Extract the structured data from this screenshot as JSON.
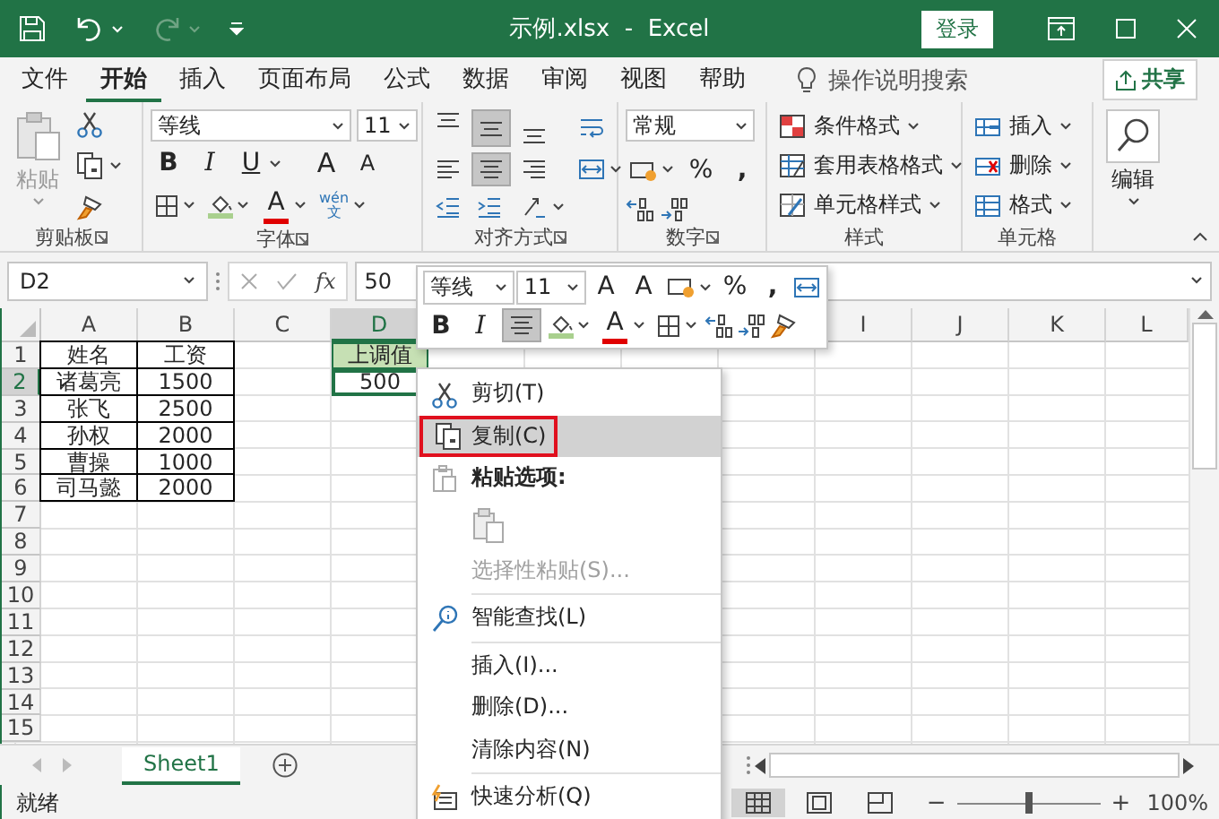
{
  "window": {
    "title": "示例.xlsx  -  Excel",
    "sign_in": "登录",
    "redo_disabled": true
  },
  "ribbon_tabs": [
    {
      "label": "文件",
      "selected": false
    },
    {
      "label": "开始",
      "selected": true
    },
    {
      "label": "插入",
      "selected": false
    },
    {
      "label": "页面布局",
      "selected": false
    },
    {
      "label": "公式",
      "selected": false
    },
    {
      "label": "数据",
      "selected": false
    },
    {
      "label": "审阅",
      "selected": false
    },
    {
      "label": "视图",
      "selected": false
    },
    {
      "label": "帮助",
      "selected": false
    }
  ],
  "tell_me": {
    "placeholder": "操作说明搜索"
  },
  "share_button": "共享",
  "ribbon_groups": [
    {
      "kind": "clipboard",
      "label": "剪贴板",
      "paste": "粘贴"
    },
    {
      "kind": "font",
      "label": "字体",
      "font": "等线",
      "size": "11",
      "bold": "B",
      "italic": "I",
      "underline": "U",
      "grow": "A",
      "shrink": "A",
      "font_color": "A",
      "phonetic_top": "wén",
      "phonetic_bottom": "文"
    },
    {
      "kind": "alignment",
      "label": "对齐方式",
      "buttons": [
        {
          "kind": "align-top",
          "on": false
        },
        {
          "kind": "align-middle",
          "on": true
        },
        {
          "kind": "align-bottom",
          "on": false
        },
        {
          "kind": "wrap",
          "on": false
        },
        {
          "kind": "align-left",
          "on": false
        },
        {
          "kind": "align-center",
          "on": true
        },
        {
          "kind": "align-right",
          "on": false
        },
        {
          "kind": "merge",
          "on": false
        },
        {
          "kind": "indent-less",
          "on": false
        },
        {
          "kind": "indent-more",
          "on": false
        },
        {
          "kind": "orientation",
          "on": false
        }
      ]
    },
    {
      "kind": "number",
      "label": "数字",
      "format": "常规",
      "percent": "%",
      "comma": ","
    },
    {
      "kind": "styles",
      "label": "样式",
      "items": [
        "条件格式",
        "套用表格格式",
        "单元格样式"
      ]
    },
    {
      "kind": "cells",
      "label": "单元格",
      "items": [
        "插入",
        "删除",
        "格式"
      ]
    },
    {
      "kind": "editing",
      "button": "编辑"
    }
  ],
  "formula_bar": {
    "name_box": "D2",
    "fx": "fx",
    "value": "50"
  },
  "sheet": {
    "columns": [
      {
        "label": "A",
        "selected": false
      },
      {
        "label": "B",
        "selected": false
      },
      {
        "label": "C",
        "selected": false
      },
      {
        "label": "D",
        "selected": true
      },
      {
        "label": "I",
        "selected": false
      },
      {
        "label": "J",
        "selected": false
      },
      {
        "label": "K",
        "selected": false
      },
      {
        "label": "L",
        "selected": false
      }
    ],
    "rows": [
      {
        "label": "1",
        "selected": false
      },
      {
        "label": "2",
        "selected": true
      },
      {
        "label": "3",
        "selected": false
      },
      {
        "label": "4",
        "selected": false
      },
      {
        "label": "5",
        "selected": false
      },
      {
        "label": "6",
        "selected": false
      },
      {
        "label": "7",
        "selected": false
      },
      {
        "label": "8",
        "selected": false
      },
      {
        "label": "9",
        "selected": false
      },
      {
        "label": "10",
        "selected": false
      },
      {
        "label": "11",
        "selected": false
      },
      {
        "label": "12",
        "selected": false
      },
      {
        "label": "13",
        "selected": false
      },
      {
        "label": "14",
        "selected": false
      },
      {
        "label": "15",
        "selected": false
      }
    ],
    "table": [
      [
        "姓名",
        "工资"
      ],
      [
        "诸葛亮",
        "1500"
      ],
      [
        "张飞",
        "2500"
      ],
      [
        "孙权",
        "2000"
      ],
      [
        "曹操",
        "1000"
      ],
      [
        "司马懿",
        "2000"
      ]
    ],
    "column_d": [
      {
        "text": "上调值",
        "kind": "filled",
        "selected": false
      },
      {
        "text": "500",
        "kind": "plain",
        "selected": true
      }
    ]
  },
  "mini_toolbar": {
    "font": "等线",
    "size": "11",
    "grow": "A",
    "shrink": "A",
    "percent": "%",
    "comma": ",",
    "bold": "B",
    "italic": "I",
    "center_on": true,
    "font_color": "A"
  },
  "context_menu": [
    {
      "kind": "cut",
      "label": "剪切(T)",
      "selected": false
    },
    {
      "kind": "copy",
      "label": "复制(C)",
      "selected": true,
      "annotated": true
    },
    {
      "kind": "paste-header",
      "label": "粘贴选项:"
    },
    {
      "kind": "paste-icon"
    },
    {
      "kind": "disabled",
      "label": "选择性粘贴(S)..."
    },
    {
      "kind": "separator"
    },
    {
      "kind": "lookup",
      "label": "智能查找(L)",
      "selected": false
    },
    {
      "kind": "separator"
    },
    {
      "kind": "plain",
      "label": "插入(I)...",
      "selected": false
    },
    {
      "kind": "plain",
      "label": "删除(D)...",
      "selected": false
    },
    {
      "kind": "plain",
      "label": "清除内容(N)",
      "selected": false
    },
    {
      "kind": "separator"
    },
    {
      "kind": "quick-analysis",
      "label": "快速分析(Q)",
      "selected": false
    }
  ],
  "sheet_tabs": [
    {
      "label": "Sheet1",
      "selected": true
    }
  ],
  "status_bar": {
    "text": "就绪",
    "views": [
      {
        "kind": "normal",
        "selected": true
      },
      {
        "kind": "page-layout",
        "selected": false
      },
      {
        "kind": "page-break",
        "selected": false
      }
    ],
    "zoom_out": "−",
    "zoom_in": "+",
    "zoom": {
      "level": 0.5
    },
    "zoom_value": "100%"
  }
}
